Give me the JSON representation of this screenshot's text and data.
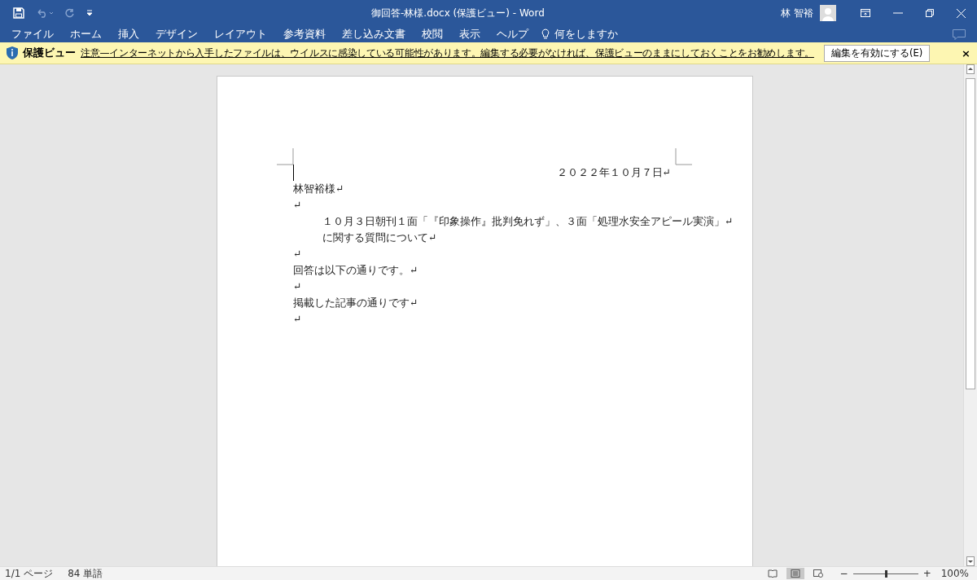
{
  "window": {
    "title": "御回答-林様.docx (保護ビュー)  -  Word",
    "user": "林 智裕"
  },
  "ribbon_tabs": [
    {
      "label": "ファイル",
      "selected": false
    },
    {
      "label": "ホーム",
      "selected": false
    },
    {
      "label": "挿入",
      "selected": false
    },
    {
      "label": "デザイン",
      "selected": false
    },
    {
      "label": "レイアウト",
      "selected": false
    },
    {
      "label": "参考資料",
      "selected": false
    },
    {
      "label": "差し込み文書",
      "selected": false
    },
    {
      "label": "校閲",
      "selected": false
    },
    {
      "label": "表示",
      "selected": false
    },
    {
      "label": "ヘルプ",
      "selected": false
    }
  ],
  "tell_me": {
    "placeholder": "何をしますか"
  },
  "protected_view": {
    "label": "保護ビュー",
    "message": "注意—インターネットから入手したファイルは、ウイルスに感染している可能性があります。編集する必要がなければ、保護ビューのままにしておくことをお勧めします。",
    "button": "編集を有効にする(E)",
    "close": "×"
  },
  "document": {
    "paragraphs": [
      {
        "kind": "right",
        "text": "２０２２年１０月７日↵"
      },
      {
        "kind": "normal",
        "text": "林智裕様↵"
      },
      {
        "kind": "normal",
        "text": "↵"
      },
      {
        "kind": "indent",
        "text": "１０月３日朝刊１面「『印象操作』批判免れず」、３面「処理水安全アピール実演」↵"
      },
      {
        "kind": "indent",
        "text": "に関する質問について↵"
      },
      {
        "kind": "normal",
        "text": "↵"
      },
      {
        "kind": "normal",
        "text": "回答は以下の通りです。↵"
      },
      {
        "kind": "normal",
        "text": "↵"
      },
      {
        "kind": "normal",
        "text": "掲載した記事の通りです↵"
      },
      {
        "kind": "normal",
        "text": "↵"
      }
    ]
  },
  "status_bar": {
    "page": "1/1 ページ",
    "words": "84 単語",
    "views": [
      {
        "kind": "read",
        "selected": false
      },
      {
        "kind": "print",
        "selected": true
      },
      {
        "kind": "web",
        "selected": false
      }
    ],
    "zoom_out": "−",
    "zoom_in": "+",
    "zoom": {
      "level": 0.5
    },
    "zoom_text": "100%"
  }
}
